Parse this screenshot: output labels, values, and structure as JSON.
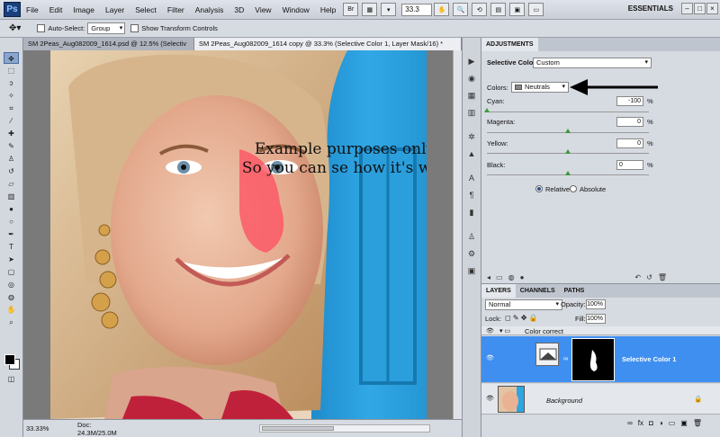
{
  "app": {
    "logo": "Ps",
    "workspace": "ESSENTIALS"
  },
  "menu": [
    "File",
    "Edit",
    "Image",
    "Layer",
    "Select",
    "Filter",
    "Analysis",
    "3D",
    "View",
    "Window",
    "Help"
  ],
  "menubar": {
    "zoom": "33.3"
  },
  "options_bar": {
    "auto_select_label": "Auto-Select:",
    "auto_select_value": "Group",
    "transform_label": "Show Transform Controls"
  },
  "document_tabs": [
    {
      "label": "SM 2Peas_Aug082009_1614.psd @ 12.5% (Selectiv",
      "active": false
    },
    {
      "label": "SM 2Peas_Aug082009_1614 copy @ 33.3% (Selective Color 1, Layer Mask/16) *",
      "active": true
    }
  ],
  "canvas": {
    "caption_line1": "Example purposes only!  Ha!",
    "caption_line2": "So you can se how it's working"
  },
  "status": {
    "zoom": "33.33%",
    "doc": "Doc: 24.3M/25.0M"
  },
  "adjustments": {
    "tab": "ADJUSTMENTS",
    "title": "Selective Color",
    "preset": "Custom",
    "colors_label": "Colors:",
    "colors_value": "Neutrals",
    "sliders": [
      {
        "label": "Cyan:",
        "value": "-100",
        "unit": "%",
        "pos": 0.0
      },
      {
        "label": "Magenta:",
        "value": "0",
        "unit": "%",
        "pos": 0.5
      },
      {
        "label": "Yellow:",
        "value": "0",
        "unit": "%",
        "pos": 0.5
      },
      {
        "label": "Black:",
        "value": "0",
        "unit": "%",
        "pos": 0.5
      }
    ],
    "method_relative": "Relative",
    "method_absolute": "Absolute"
  },
  "layers": {
    "tabs": [
      "LAYERS",
      "CHANNELS",
      "PATHS"
    ],
    "blend_mode": "Normal",
    "opacity_label": "Opacity:",
    "opacity_value": "100%",
    "lock_label": "Lock:",
    "fill_label": "Fill:",
    "fill_value": "100%",
    "group_name": "Color correct",
    "adjustment_layer_name": "Selective Color 1",
    "background_layer_name": "Background"
  },
  "colors": {
    "accent": "#3f8ff0",
    "wall": "#2fa6e2"
  }
}
